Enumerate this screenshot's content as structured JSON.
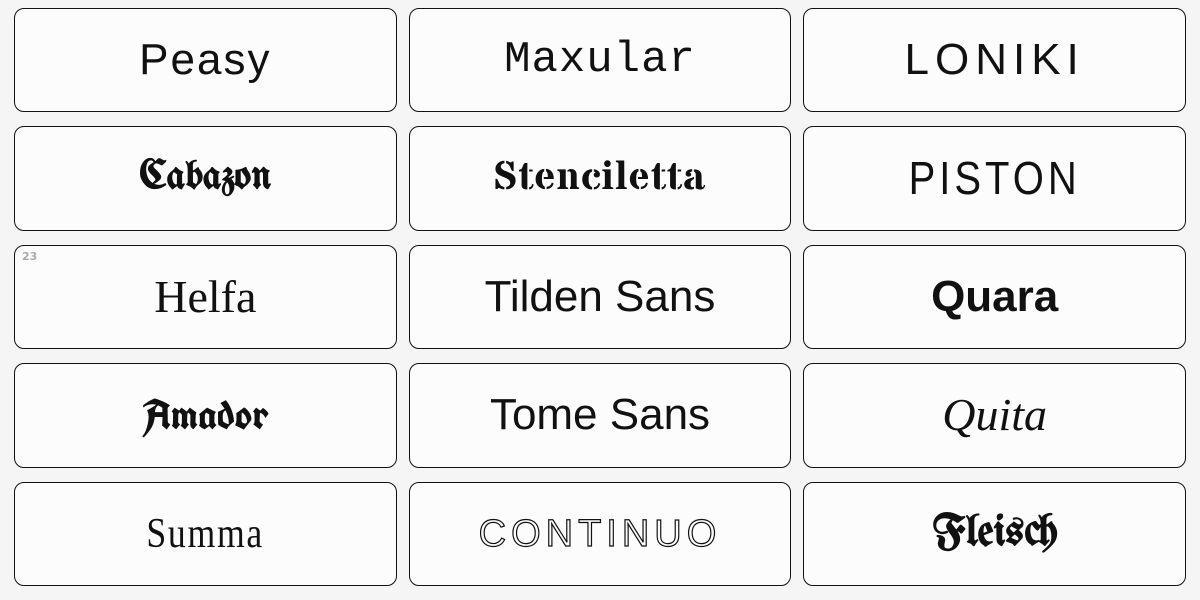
{
  "fonts": [
    {
      "name": "Peasy",
      "style_class": "f-peasy",
      "badge": ""
    },
    {
      "name": "Maxular",
      "style_class": "f-maxular",
      "badge": ""
    },
    {
      "name": "LONIKI",
      "style_class": "f-loniki",
      "badge": ""
    },
    {
      "name": "Cabazon",
      "style_class": "f-cabazon",
      "badge": ""
    },
    {
      "name": "Stenciletta",
      "style_class": "f-stenciletta",
      "badge": ""
    },
    {
      "name": "PISTON",
      "style_class": "f-piston",
      "badge": ""
    },
    {
      "name": "Helfa",
      "style_class": "f-helfa",
      "badge": "23"
    },
    {
      "name": "Tilden Sans",
      "style_class": "f-tilden",
      "badge": ""
    },
    {
      "name": "Quara",
      "style_class": "f-quara",
      "badge": ""
    },
    {
      "name": "Amador",
      "style_class": "f-amador",
      "badge": ""
    },
    {
      "name": "Tome Sans",
      "style_class": "f-tome",
      "badge": ""
    },
    {
      "name": "Quita",
      "style_class": "f-quita",
      "badge": ""
    },
    {
      "name": "Summa",
      "style_class": "f-summa",
      "badge": ""
    },
    {
      "name": "CONTINUO",
      "style_class": "f-continuo",
      "badge": ""
    },
    {
      "name": "Fleisch",
      "style_class": "f-fleisch",
      "badge": ""
    }
  ]
}
